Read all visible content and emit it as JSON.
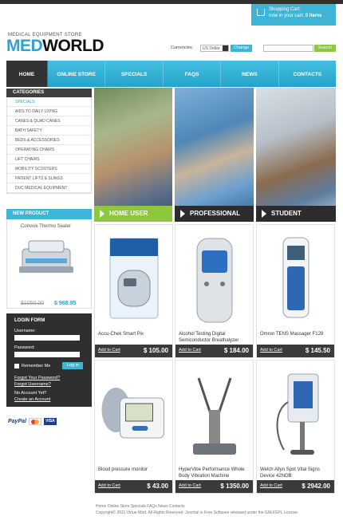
{
  "cart": {
    "title": "Shopping Cart:",
    "status_prefix": "now in your cart: ",
    "count": "0 items"
  },
  "brand": {
    "tagline": "MEDICAL EQUIPMENT STORE",
    "logo_a": "MED",
    "logo_b": "WORLD"
  },
  "currency": {
    "label": "Currencies:",
    "selected": "US Dollar",
    "change": "Change"
  },
  "search": {
    "button": "Search"
  },
  "nav": [
    "HOME",
    "ONLINE STORE",
    "SPECIALS",
    "FAQS",
    "NEWS",
    "CONTACTS"
  ],
  "categories": {
    "title": "CATEGORIES",
    "items": [
      "SPECIALS",
      "AIDS TO DAILY LIVING",
      "CANES & QUAD CANES",
      "BATH SAFETY",
      "BEDS & ACCESSORIES",
      "OPERATING CHAIRS",
      "LIFT CHAIRS",
      "MOBILITY SCOOTERS",
      "PATIENT LIFTS & SLINGS",
      "DUC MEDICAL EQUIPMENT"
    ]
  },
  "new_product": {
    "title": "NEW PRODUCT",
    "name": "Convoix Thermo Sealer",
    "old_price": "$1050.00",
    "new_price": "$ 968.95"
  },
  "login": {
    "title": "LOGIN FORM",
    "username": "Username:",
    "password": "Password:",
    "remember": "Remember Me",
    "login_btn": "Log in",
    "forgot_password": "Forgot Your Password?",
    "forgot_username": "Forgot Username?",
    "no_account": "No Account Yet?",
    "create": "Create an Account"
  },
  "payments": {
    "paypal": "PayPal",
    "visa": "VISA"
  },
  "banners": [
    "HOME USER",
    "PROFESSIONAL",
    "STUDENT"
  ],
  "products": [
    {
      "name": "Accu-Chek Smart Pix",
      "price": "$ 105.00",
      "add": "Add to Cart"
    },
    {
      "name": "Alcohol Testing Digital Semiconductor Breathalyzer",
      "price": "$ 184.00",
      "add": "Add to Cart"
    },
    {
      "name": "Omron TENS Massager F128",
      "price": "$ 145.50",
      "add": "Add to Cart"
    },
    {
      "name": "Blood pressure monitor",
      "price": "$ 43.00",
      "add": "Add to Cart"
    },
    {
      "name": "HyperVibe Performance Whole Body Vibration Machine",
      "price": "$ 1350.00",
      "add": "Add to Cart"
    },
    {
      "name": "Welch Allyn Spot Vital Signs Device 42NOB",
      "price": "$ 2942.00",
      "add": "Add to Cart"
    }
  ],
  "footer": {
    "links": "Home   Online Store   Specials   FAQs   News   Contacts",
    "copyright": "Copyright© 2011 Virtue Mart. All Rights Reserved. Joomla! is Free Software released under the GNU/GPL License."
  },
  "colors": {
    "accent": "#3fb4d4",
    "green": "#8dc63f",
    "dark": "#2f2f2f"
  }
}
